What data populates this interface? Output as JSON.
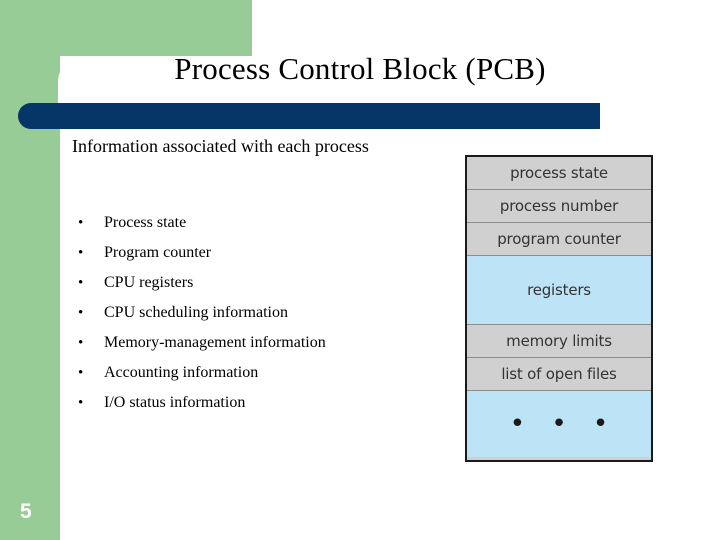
{
  "slide": {
    "title": "Process Control Block (PCB)",
    "number": "5",
    "lead": "Information associated with each process",
    "bullet_marker": "•",
    "bullets": [
      "Process state",
      "Program counter",
      "CPU registers",
      "CPU scheduling information",
      "Memory-management information",
      "Accounting information",
      "I/O status information"
    ]
  },
  "diagram": {
    "name": "process-control-block",
    "rows": [
      {
        "label": "process state",
        "fill": "gray",
        "size": "h-small"
      },
      {
        "label": "process number",
        "fill": "gray",
        "size": "h-small"
      },
      {
        "label": "program counter",
        "fill": "gray",
        "size": "h-small"
      },
      {
        "label": "registers",
        "fill": "blue",
        "size": "h-tall"
      },
      {
        "label": "memory limits",
        "fill": "gray",
        "size": "h-small"
      },
      {
        "label": "list of open files",
        "fill": "gray",
        "size": "h-small"
      },
      {
        "label": "• • •",
        "fill": "blue",
        "size": "h-last"
      }
    ]
  },
  "colors": {
    "green_panel": "#97cc96",
    "title_bar_blue": "#063567",
    "diagram_gray": "#d0d0d0",
    "diagram_blue": "#bde3f7",
    "background": "#ffffff"
  }
}
